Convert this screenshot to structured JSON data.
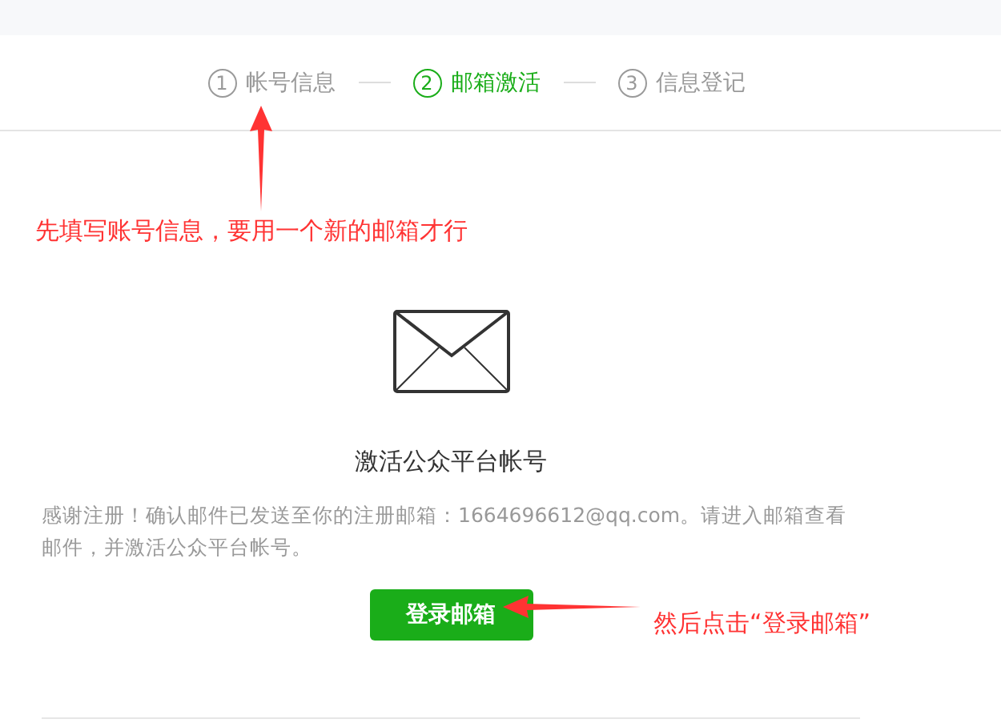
{
  "steps": [
    {
      "number": "1",
      "label": "帐号信息",
      "selected": false
    },
    {
      "number": "2",
      "label": "邮箱激活",
      "selected": true
    },
    {
      "number": "3",
      "label": "信息登记",
      "selected": false
    }
  ],
  "activation": {
    "title": "激活公众平台帐号",
    "message": "感谢注册！确认邮件已发送至你的注册邮箱：1664696612@qq.com。请进入邮箱查看邮件，并激活公众平台帐号。",
    "button": "登录邮箱"
  },
  "annotations": [
    "先填写账号信息，要用一个新的邮箱才行",
    "然后点击“登录邮箱”"
  ]
}
